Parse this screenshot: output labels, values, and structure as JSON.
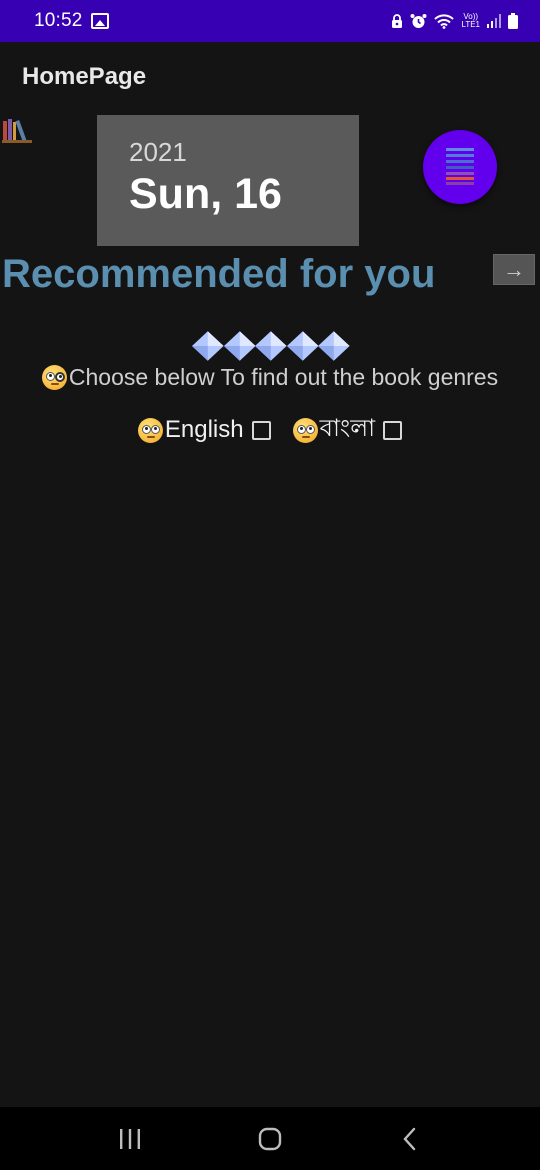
{
  "status_bar": {
    "time": "10:52",
    "network_text_top": "Vo))",
    "network_text_bottom": "LTE1",
    "background_color": "#3700b3"
  },
  "app": {
    "title": "HomePage"
  },
  "date_card": {
    "year": "2021",
    "day": "Sun, 16"
  },
  "fab": {
    "icon": "list-menu-icon",
    "color": "#6200ee"
  },
  "recommended": {
    "title": "Recommended for you",
    "title_color": "#5b8fb0",
    "next_arrow": "→"
  },
  "genres": {
    "prompt": "Choose below  To find out the book genres",
    "options": [
      {
        "label": "English",
        "checked": false
      },
      {
        "label": "বাংলা",
        "checked": false
      }
    ]
  },
  "nav": {
    "recent_icon": "recent-apps-icon",
    "home_icon": "home-icon",
    "back_icon": "back-icon"
  }
}
